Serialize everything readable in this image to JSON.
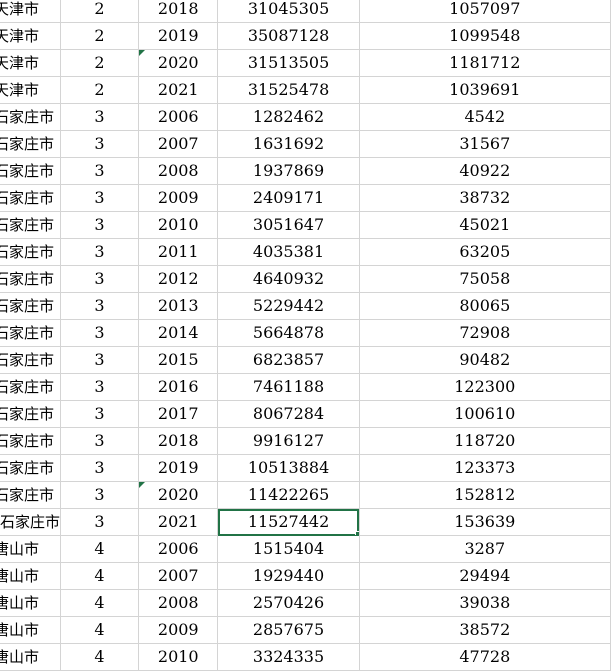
{
  "rows": [
    {
      "city": "天津市",
      "code": "2",
      "year": "2018",
      "pop": "31045305",
      "val": "1057097"
    },
    {
      "city": "天津市",
      "code": "2",
      "year": "2019",
      "pop": "35087128",
      "val": "1099548"
    },
    {
      "city": "天津市",
      "code": "2",
      "year": "2020",
      "pop": "31513505",
      "val": "1181712",
      "note": true
    },
    {
      "city": "天津市",
      "code": "2",
      "year": "2021",
      "pop": "31525478",
      "val": "1039691"
    },
    {
      "city": "石家庄市",
      "code": "3",
      "year": "2006",
      "pop": "1282462",
      "val": "4542"
    },
    {
      "city": "石家庄市",
      "code": "3",
      "year": "2007",
      "pop": "1631692",
      "val": "31567"
    },
    {
      "city": "石家庄市",
      "code": "3",
      "year": "2008",
      "pop": "1937869",
      "val": "40922"
    },
    {
      "city": "石家庄市",
      "code": "3",
      "year": "2009",
      "pop": "2409171",
      "val": "38732"
    },
    {
      "city": "石家庄市",
      "code": "3",
      "year": "2010",
      "pop": "3051647",
      "val": "45021"
    },
    {
      "city": "石家庄市",
      "code": "3",
      "year": "2011",
      "pop": "4035381",
      "val": "63205"
    },
    {
      "city": "石家庄市",
      "code": "3",
      "year": "2012",
      "pop": "4640932",
      "val": "75058"
    },
    {
      "city": "石家庄市",
      "code": "3",
      "year": "2013",
      "pop": "5229442",
      "val": "80065"
    },
    {
      "city": "石家庄市",
      "code": "3",
      "year": "2014",
      "pop": "5664878",
      "val": "72908"
    },
    {
      "city": "石家庄市",
      "code": "3",
      "year": "2015",
      "pop": "6823857",
      "val": "90482"
    },
    {
      "city": "石家庄市",
      "code": "3",
      "year": "2016",
      "pop": "7461188",
      "val": "122300"
    },
    {
      "city": "石家庄市",
      "code": "3",
      "year": "2017",
      "pop": "8067284",
      "val": "100610"
    },
    {
      "city": "石家庄市",
      "code": "3",
      "year": "2018",
      "pop": "9916127",
      "val": "118720"
    },
    {
      "city": "石家庄市",
      "code": "3",
      "year": "2019",
      "pop": "10513884",
      "val": "123373"
    },
    {
      "city": "石家庄市",
      "code": "3",
      "year": "2020",
      "pop": "11422265",
      "val": "152812",
      "note": true
    },
    {
      "city": "石家庄市",
      "code": "3",
      "year": "2021",
      "pop": "11527442",
      "val": "153639",
      "selected": true
    },
    {
      "city": "唐山市",
      "code": "4",
      "year": "2006",
      "pop": "1515404",
      "val": "3287"
    },
    {
      "city": "唐山市",
      "code": "4",
      "year": "2007",
      "pop": "1929440",
      "val": "29494"
    },
    {
      "city": "唐山市",
      "code": "4",
      "year": "2008",
      "pop": "2570426",
      "val": "39038"
    },
    {
      "city": "唐山市",
      "code": "4",
      "year": "2009",
      "pop": "2857675",
      "val": "38572"
    },
    {
      "city": "唐山市",
      "code": "4",
      "year": "2010",
      "pop": "3324335",
      "val": "47728"
    }
  ]
}
